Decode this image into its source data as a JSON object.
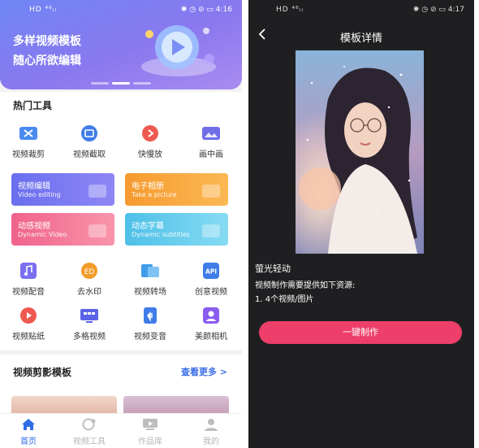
{
  "left_screen": {
    "status": {
      "signal": "HD ⁴⁶ᵢₗ",
      "battery_time": "✺ ◷ ⊘ ▭ 4:16"
    },
    "banner": {
      "line1": "多样视频模板",
      "line2": "随心所欲编辑"
    },
    "hot_tools": {
      "title": "热门工具",
      "items": [
        {
          "label": "视频裁剪",
          "icon": "video-crop-icon",
          "color": "#4a8af0"
        },
        {
          "label": "视频截取",
          "icon": "video-capture-icon",
          "color": "#3f7ce8"
        },
        {
          "label": "快慢放",
          "icon": "speed-icon",
          "color": "#ee5a52"
        },
        {
          "label": "画中画",
          "icon": "picture-in-picture-icon",
          "color": "#6f6ee8"
        }
      ]
    },
    "feature_cards": [
      {
        "title": "视频编辑",
        "subtitle": "Video editing",
        "color": "#6d74ee"
      },
      {
        "title": "电子相册",
        "subtitle": "Take a picture",
        "color": "#f7a53b"
      },
      {
        "title": "动感视频",
        "subtitle": "Dynamic Video",
        "color": "#f1678f"
      },
      {
        "title": "动态字幕",
        "subtitle": "Dynamic subtitles",
        "color": "#53c4e8"
      }
    ],
    "tools2": [
      {
        "label": "视频配音",
        "icon": "dubbing-icon",
        "color": "#7b6ff0"
      },
      {
        "label": "去水印",
        "icon": "remove-watermark-icon",
        "color": "#f39b2b"
      },
      {
        "label": "视频转场",
        "icon": "transition-icon",
        "color": "#3f9ce8"
      },
      {
        "label": "创意视频",
        "icon": "api-icon",
        "color": "#3f7ce8"
      },
      {
        "label": "视频贴纸",
        "icon": "sticker-icon",
        "color": "#ee5a52"
      },
      {
        "label": "多格视频",
        "icon": "grid-video-icon",
        "color": "#5b63e8"
      },
      {
        "label": "视频变音",
        "icon": "voice-change-icon",
        "color": "#3f7ce8"
      },
      {
        "label": "美颜相机",
        "icon": "beauty-camera-icon",
        "color": "#8a5cf0"
      }
    ],
    "templates": {
      "title": "视频剪影模板",
      "more": "查看更多 >"
    },
    "tabbar": [
      {
        "label": "首页",
        "icon": "home-icon",
        "active": true
      },
      {
        "label": "视频工具",
        "icon": "video-tools-icon",
        "active": false
      },
      {
        "label": "作品库",
        "icon": "works-library-icon",
        "active": false
      },
      {
        "label": "我的",
        "icon": "profile-icon",
        "active": false
      }
    ]
  },
  "right_screen": {
    "status": {
      "signal": "HD ⁴⁶ᵢₗ",
      "battery_time": "✺ ◷ ⊘ ▭ 4:17"
    },
    "nav_title": "模板详情",
    "template_name": "萤光轻动",
    "requirement": "视频制作需要提供如下资源:",
    "resource": "1. 4个视频/图片",
    "make_button": "一键制作"
  },
  "colors": {
    "accent_blue": "#2f6de8",
    "make_pink": "#ee3e6a",
    "dark_bg": "#1f1f21"
  }
}
